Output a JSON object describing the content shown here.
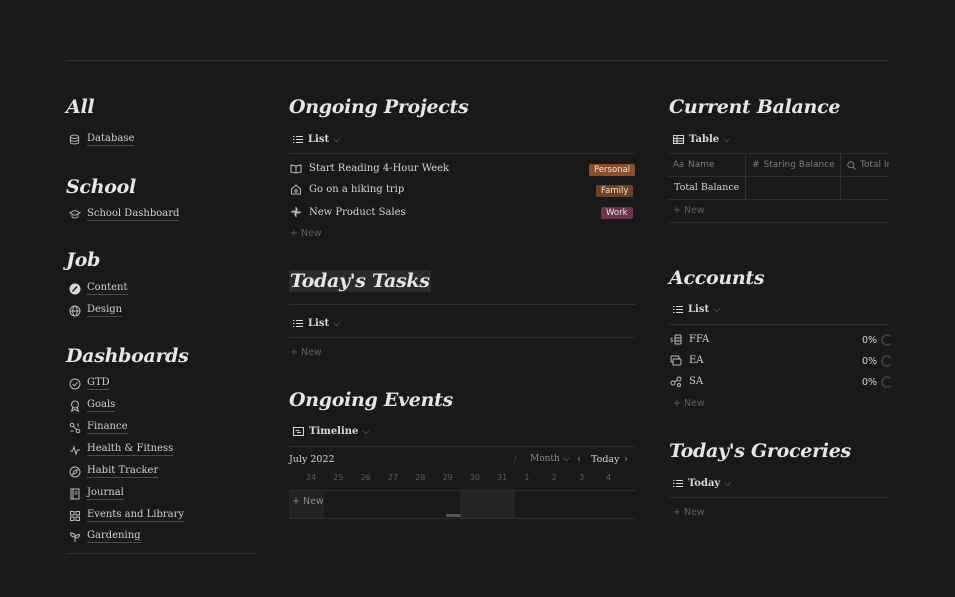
{
  "left": {
    "all": {
      "title": "All",
      "items": [
        {
          "label": "Database",
          "icon": "database-icon"
        }
      ]
    },
    "school": {
      "title": "School",
      "items": [
        {
          "label": "School Dashboard",
          "icon": "graduation-cap-icon"
        }
      ]
    },
    "job": {
      "title": "Job",
      "items": [
        {
          "label": "Content",
          "icon": "content-icon"
        },
        {
          "label": "Design",
          "icon": "globe-icon"
        }
      ]
    },
    "dashboards": {
      "title": "Dashboards",
      "items": [
        {
          "label": "GTD",
          "icon": "check-circle-icon"
        },
        {
          "label": "Goals",
          "icon": "award-icon"
        },
        {
          "label": "Finance",
          "icon": "finance-icon"
        },
        {
          "label": "Health & Fitness",
          "icon": "fitness-icon"
        },
        {
          "label": "Habit Tracker",
          "icon": "compass-icon"
        },
        {
          "label": "Journal",
          "icon": "journal-icon"
        },
        {
          "label": "Events and Library",
          "icon": "grid-icon"
        },
        {
          "label": "Gardening",
          "icon": "sprout-icon"
        }
      ]
    }
  },
  "ongoing_projects": {
    "title": "Ongoing Projects",
    "view": "List",
    "rows": [
      {
        "label": "Start Reading 4-Hour Week",
        "icon": "book-icon",
        "tag": "Personal",
        "tag_color": "#8a4f2a"
      },
      {
        "label": "Go on a hiking trip",
        "icon": "home-icon",
        "tag": "Family",
        "tag_color": "#6e4325"
      },
      {
        "label": "New Product Sales",
        "icon": "pinwheel-icon",
        "tag": "Work",
        "tag_color": "#6b3450"
      }
    ],
    "new_label": "+ New"
  },
  "todays_tasks": {
    "title": "Today's Tasks",
    "view": "List",
    "new_label": "+ New"
  },
  "ongoing_events": {
    "title": "Ongoing Events",
    "view": "Timeline",
    "month_label": "July 2022",
    "range_label": "Month",
    "today_label": "Today",
    "days": [
      "24",
      "25",
      "26",
      "27",
      "28",
      "29",
      "30",
      "31",
      "1",
      "2",
      "3",
      "4"
    ],
    "new_label": "+ New"
  },
  "current_balance": {
    "title": "Current Balance",
    "view": "Table",
    "columns": [
      "Name",
      "Staring Balance",
      "Total In"
    ],
    "column_icons": [
      "Aa",
      "#",
      "search-icon"
    ],
    "rows": [
      {
        "name": "Total Balance"
      }
    ],
    "new_label": "+ New"
  },
  "accounts": {
    "title": "Accounts",
    "view": "List",
    "rows": [
      {
        "label": "FFA",
        "icon": "money-icon",
        "pct": "0%"
      },
      {
        "label": "EA",
        "icon": "cards-icon",
        "pct": "0%"
      },
      {
        "label": "SA",
        "icon": "link-icon",
        "pct": "0%"
      }
    ],
    "new_label": "+ New"
  },
  "todays_groceries": {
    "title": "Today's Groceries",
    "view": "Today",
    "new_label": "+ New"
  }
}
